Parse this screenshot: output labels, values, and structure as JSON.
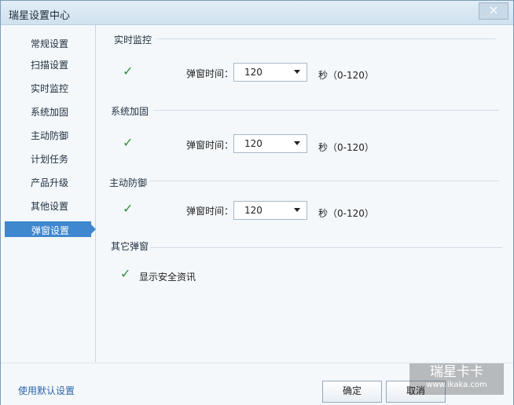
{
  "window": {
    "title": "瑞星设置中心",
    "close": "×"
  },
  "sidebar": {
    "items": [
      "常规设置",
      "扫描设置",
      "实时监控",
      "系统加固",
      "主动防御",
      "计划任务",
      "产品升级",
      "其他设置"
    ],
    "active": "弹窗设置"
  },
  "sections": {
    "realtime": {
      "title": "实时监控",
      "label": "弹窗时间：",
      "value": "120",
      "unit": "秒（0-120）"
    },
    "system": {
      "title": "系统加固",
      "label": "弹窗时间：",
      "value": "120",
      "unit": "秒（0-120）"
    },
    "active_defense": {
      "title": "主动防御",
      "label": "弹窗时间：",
      "value": "120",
      "unit": "秒（0-120）"
    },
    "other": {
      "title": "其它弹窗",
      "option": "显示安全资讯"
    }
  },
  "footer": {
    "default_link": "使用默认设置",
    "ok": "确定",
    "cancel": "取消"
  },
  "watermark": {
    "line1": "瑞星卡卡",
    "line2": "www.ikaka.com"
  }
}
